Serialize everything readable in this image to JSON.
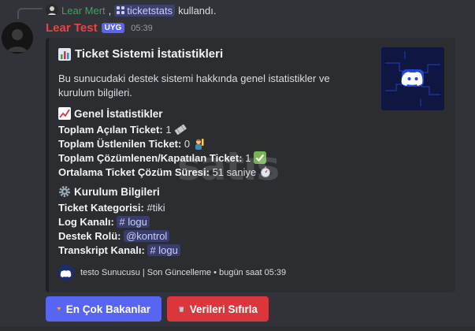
{
  "reply": {
    "user": "Lear Mert",
    "separator": ",",
    "command": "ticketstats",
    "suffix": "kullandı."
  },
  "message": {
    "author": "Lear Test",
    "tag": "UYG",
    "time": "05:39"
  },
  "embed": {
    "title": "Ticket Sistemi İstatistikleri",
    "description": "Bu sunucudaki destek sistemi hakkında genel istatistikler ve kurulum bilgileri.",
    "general": {
      "title": "Genel İstatistikler",
      "opened_label": "Toplam Açılan Ticket:",
      "opened_value": "1",
      "claimed_label": "Toplam Üstlenilen Ticket:",
      "claimed_value": "0",
      "resolved_label": "Toplam Çözümlenen/Kapatılan Ticket:",
      "resolved_value": "1",
      "avg_label": "Ortalama Ticket Çözüm Süresi:",
      "avg_value": "51 saniye"
    },
    "setup": {
      "title": "Kurulum Bilgileri",
      "category_label": "Ticket Kategorisi:",
      "category_value": "#tiki",
      "log_label": "Log Kanalı:",
      "log_value": "# logu",
      "role_label": "Destek Rolü:",
      "role_value": "@kontrol",
      "transcript_label": "Transkript Kanalı:",
      "transcript_value": "# logu"
    },
    "footer": "testo Sunucusu | Son Güncelleme • bugün saat 05:39"
  },
  "watermark": "satıs",
  "buttons": {
    "top_viewers": "En Çok Bakanlar",
    "reset": "Verileri Sıfırla"
  },
  "colors": {
    "background": "#313338",
    "embed": "#2b2d31",
    "username": "#f23f42",
    "reply_user": "#3ba55d",
    "blurple": "#5865f2",
    "danger": "#da373c"
  },
  "icons": {
    "title": "bar-chart-icon",
    "general": "chart-increasing-icon",
    "setup": "gear-icon",
    "opened": "ticket-icon",
    "claimed": "person-raising-hand-icon",
    "resolved": "check-mark-icon",
    "avg": "stopwatch-icon",
    "thumbnail": "discord-logo-icon",
    "top_viewers": "trophy-icon",
    "reset": "wastebasket-icon"
  }
}
